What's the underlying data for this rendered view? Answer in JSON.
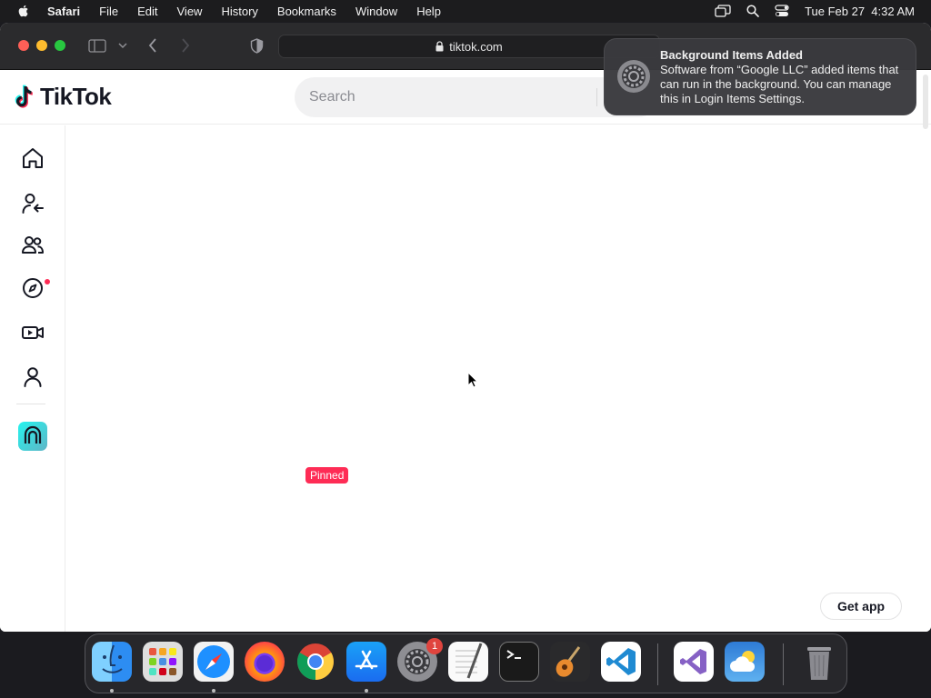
{
  "menubar": {
    "app_name": "Safari",
    "items": [
      "File",
      "Edit",
      "View",
      "History",
      "Bookmarks",
      "Window",
      "Help"
    ],
    "clock": "Tue Feb 27  4:32 AM"
  },
  "browser": {
    "url": "tiktok.com"
  },
  "tiktok": {
    "logo_text": "TikTok",
    "search_placeholder": "Search",
    "sidebar": [
      "home-icon",
      "following-icon",
      "friends-icon",
      "explore-icon",
      "live-icon",
      "profile-icon",
      "creator-icon"
    ],
    "pinned_label": "Pinned",
    "get_app_label": "Get app"
  },
  "notification": {
    "title": "Background Items Added",
    "body": "Software from “Google LLC” added items that can run in the background. You can manage this in Login Items Settings."
  },
  "dock": {
    "apps": [
      "Finder",
      "Launchpad",
      "Safari",
      "Firefox",
      "Chrome",
      "App Store",
      "System Settings",
      "TextEdit",
      "Terminal",
      "GarageBand",
      "VS Code",
      "Visual Studio",
      "Weather",
      "Trash"
    ],
    "settings_badge": "1"
  },
  "colors": {
    "tiktok_red": "#fe2c55",
    "tiktok_cyan": "#25f4ee",
    "menubar_bg": "#1c1c1e"
  }
}
